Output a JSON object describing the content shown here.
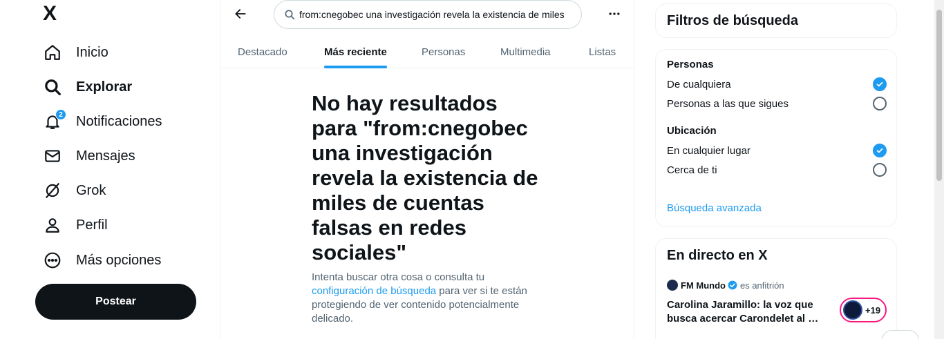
{
  "nav": {
    "logo": "X",
    "items": [
      {
        "label": "Inicio",
        "icon": "home-icon"
      },
      {
        "label": "Explorar",
        "icon": "search-icon"
      },
      {
        "label": "Notificaciones",
        "icon": "bell-icon",
        "badge": "2"
      },
      {
        "label": "Mensajes",
        "icon": "mail-icon"
      },
      {
        "label": "Grok",
        "icon": "grok-icon"
      },
      {
        "label": "Perfil",
        "icon": "person-icon"
      },
      {
        "label": "Más opciones",
        "icon": "more-circle-icon"
      }
    ],
    "post_label": "Postear"
  },
  "search": {
    "query": "from:cnegobec una investigación revela la existencia de miles"
  },
  "tabs": [
    "Destacado",
    "Más reciente",
    "Personas",
    "Multimedia",
    "Listas"
  ],
  "empty_state": {
    "title": "No hay resultados para \"from:cnegobec una investigación revela la existencia de miles de cuentas falsas en redes sociales\"",
    "text_before": "Intenta buscar otra cosa o consulta tu ",
    "link": "configuración de búsqueda",
    "text_after": " para ver si te están protegiendo de ver contenido potencialmente delicado."
  },
  "filters": {
    "title": "Filtros de búsqueda",
    "people_title": "Personas",
    "people_options": [
      "De cualquiera",
      "Personas a las que sigues"
    ],
    "location_title": "Ubicación",
    "location_options": [
      "En cualquier lugar",
      "Cerca de ti"
    ],
    "advanced": "Búsqueda avanzada"
  },
  "live": {
    "title": "En directo en X",
    "host": "FM Mundo",
    "host_role": "es anfitrión",
    "space_title": "Carolina Jaramillo: la voz que busca acercar Carondelet al …",
    "listeners": "+19"
  },
  "colors": {
    "accent": "#1d9bf0",
    "text": "#0f1419",
    "secondary": "#536471",
    "live_ring": "#f91880"
  }
}
